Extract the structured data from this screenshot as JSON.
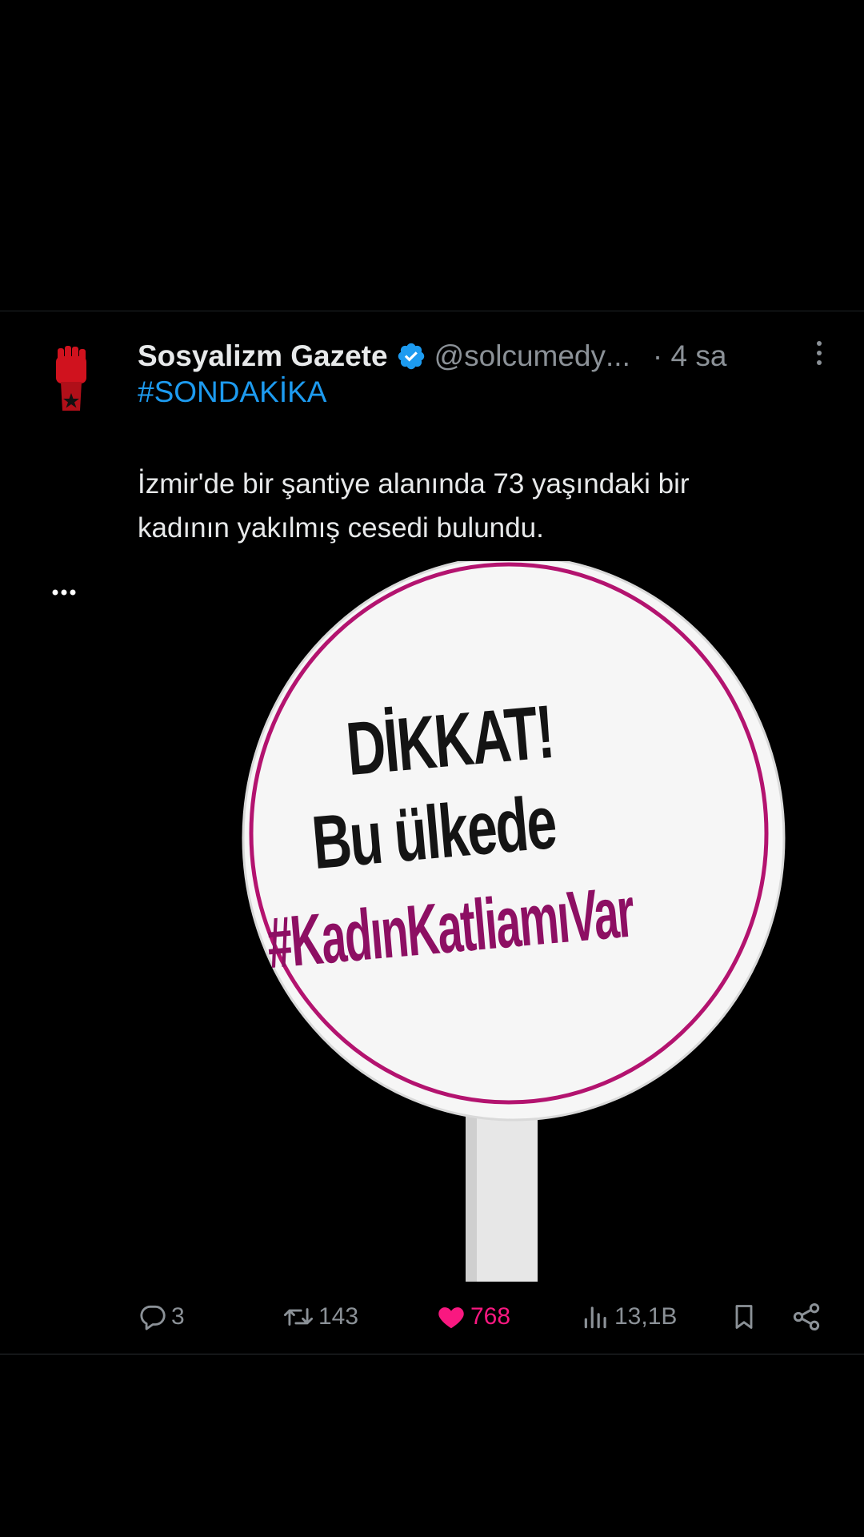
{
  "tweet": {
    "display_name": "Sosyalizm Gazete",
    "handle": "@solcumedy",
    "handle_truncation": "...",
    "timestamp": "· 4 sa",
    "hashtag": "#SONDAKİKA",
    "body_line1": "İzmir'de bir şantiye alanında 73 yaşındaki bir",
    "body_line2": "kadının yakılmış cesedi bulundu.",
    "media": {
      "sign_line1": "DİKKAT!",
      "sign_line2": "Bu ülkede",
      "sign_line3": "#KadınKatliamıVar"
    },
    "actions": {
      "reply_count": "3",
      "retweet_count": "143",
      "like_count": "768",
      "views_count": "13,1B"
    }
  },
  "icons": {
    "verified": "verified-badge-icon",
    "more": "more-vertical-icon",
    "reply": "reply-icon",
    "retweet": "retweet-icon",
    "like": "heart-icon",
    "views": "views-icon",
    "bookmark": "bookmark-icon",
    "share": "share-icon"
  },
  "colors": {
    "background": "#000000",
    "text_primary": "#e7e9ea",
    "text_secondary": "#8b9197",
    "link": "#1d9bf0",
    "like": "#f91880",
    "sign_accent": "#b3136f",
    "avatar_red": "#d0121e"
  }
}
